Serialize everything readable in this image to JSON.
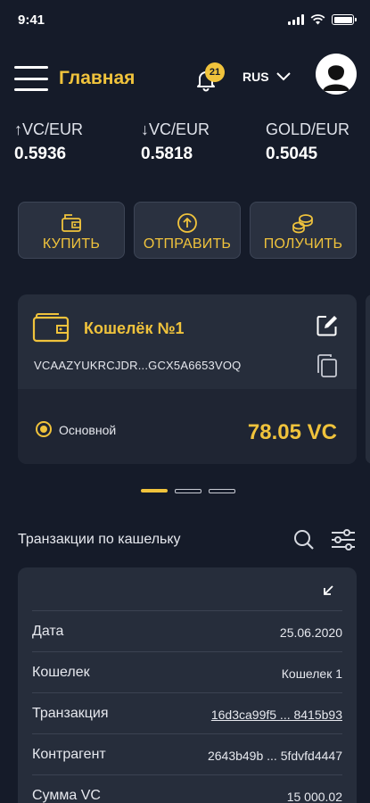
{
  "status_bar": {
    "time": "9:41"
  },
  "header": {
    "title": "Главная",
    "notifications_count": "21",
    "language": "RUS",
    "menu_icon": "hamburger-icon",
    "bell_icon": "bell-icon",
    "avatar_icon": "user-avatar-icon"
  },
  "rates": [
    {
      "label": "↑VC/EUR",
      "value": "0.5936"
    },
    {
      "label": "↓VC/EUR",
      "value": "0.5818"
    },
    {
      "label": "GOLD/EUR",
      "value": "0.5045"
    }
  ],
  "actions": [
    {
      "label": "КУПИТЬ",
      "icon": "wallet-buy-icon"
    },
    {
      "label": "ОТПРАВИТЬ",
      "icon": "send-arrow-icon"
    },
    {
      "label": "ПОЛУЧИТЬ",
      "icon": "coins-icon"
    }
  ],
  "wallet": {
    "name": "Кошелёк №1",
    "address": "VCAAZYUKRCJDR...GCX5A6653VOQ",
    "type_label": "Основной",
    "balance": "78.05 VC",
    "edit_icon": "edit-icon",
    "copy_icon": "copy-icon"
  },
  "carousel": {
    "total": 3,
    "active": 0
  },
  "transactions": {
    "title": "Транзакции по кашельку",
    "rows": [
      {
        "key": "Дата",
        "value": "25.06.2020"
      },
      {
        "key": "Кошелек",
        "value": "Кошелек 1"
      },
      {
        "key": "Транзакция",
        "value": "16d3ca99f5 ... 8415b93"
      },
      {
        "key": "Контрагент",
        "value": "2643b49b ... 5fdvfd4447"
      },
      {
        "key": "Сумма VC",
        "value": "15 000.02"
      }
    ]
  },
  "colors": {
    "accent": "#f0c33c",
    "background": "#151b29",
    "card": "#262d3b"
  }
}
